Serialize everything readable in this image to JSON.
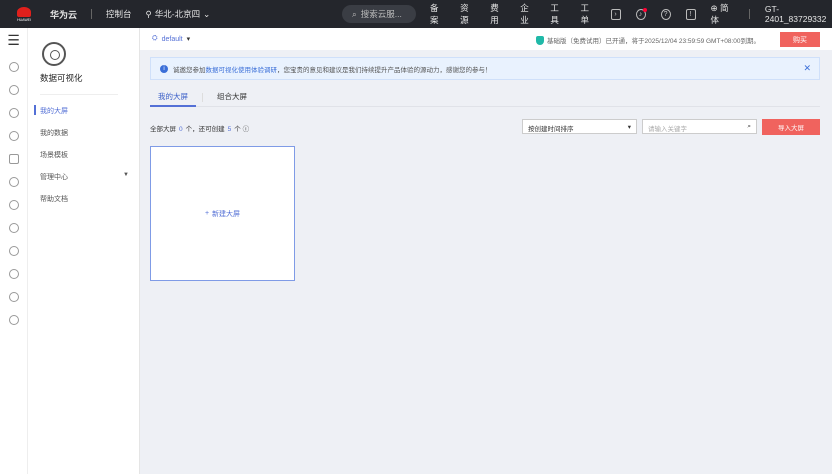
{
  "topbar": {
    "logo_text": "HUAWEI",
    "brand": "华为云",
    "console": "控制台",
    "region": "华北-北京四",
    "search_placeholder": "搜索云服...",
    "nav": [
      "备案",
      "资源",
      "费用",
      "企业",
      "工具",
      "工单"
    ],
    "language": "简体",
    "user": "GT-2401_83729332"
  },
  "rail": {
    "menu_icon": "menu-icon"
  },
  "sidebar": {
    "title": "数据可视化",
    "items": [
      {
        "label": "我的大屏",
        "active": true
      },
      {
        "label": "我的数据"
      },
      {
        "label": "场景模板"
      },
      {
        "label": "管理中心",
        "expandable": true
      },
      {
        "label": "帮助文档"
      }
    ]
  },
  "subheader": {
    "workspace": "default",
    "notice": "基础版（免费试用）已开通，将于2025/12/04 23:59:59 GMT+08:00到期。",
    "buy": "购买"
  },
  "banner": {
    "prefix": "诚邀您参加",
    "link": "数据可视化使用体验调研",
    "suffix": "，您宝贵的意见和建议是我们持续提升产品体验的源动力，感谢您的参与！"
  },
  "tabs": [
    "我的大屏",
    "组合大屏"
  ],
  "toolbar": {
    "count_prefix": "全部大屏",
    "count": "0",
    "unit1": "个，还可创建",
    "remaining": "5",
    "unit2": "个",
    "sort": "按创建时间排序",
    "search_placeholder": "请输入关键字",
    "import": "导入大屏"
  },
  "card": {
    "new": "新建大屏"
  },
  "colors": {
    "accent": "#5470d6",
    "primary_button": "#f0635e",
    "topbar": "#24262c"
  }
}
